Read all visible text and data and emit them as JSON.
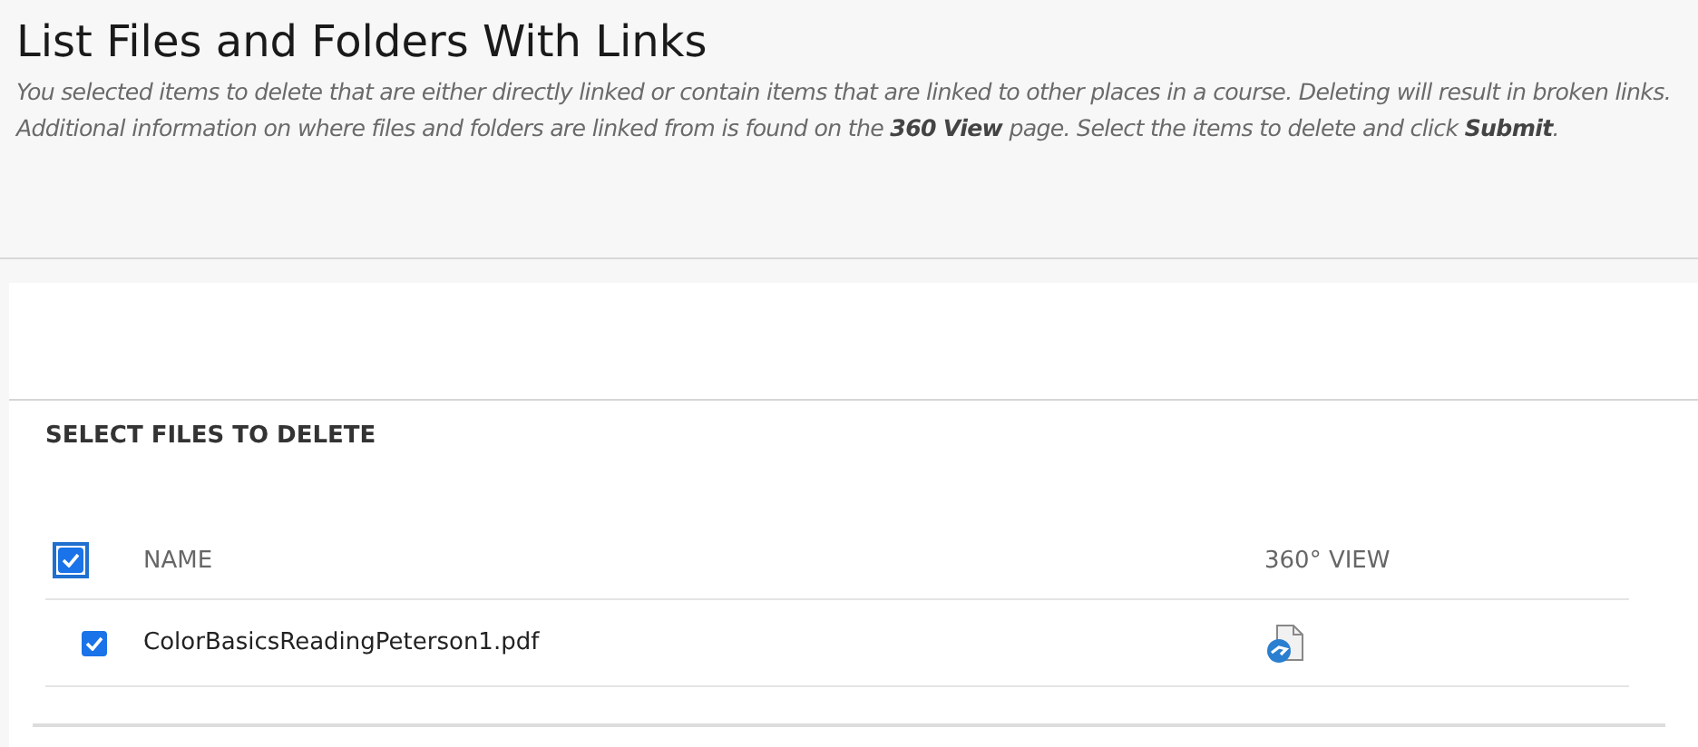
{
  "page": {
    "title": "List Files and Folders With Links",
    "description": "You selected items to delete that are either directly linked or contain items that are linked to other places in a course. Deleting will result in broken links. Additional information on where files and folders are linked from is found on the **360 View** page. Select the items to delete and click **Submit**."
  },
  "section": {
    "heading": "SELECT FILES TO DELETE"
  },
  "table": {
    "select_all": {
      "checked": true
    },
    "columns": [
      "NAME",
      "360° VIEW"
    ],
    "rows": [
      {
        "name": "ColorBasicsReadingPeterson1.pdf",
        "checked": true
      }
    ]
  }
}
